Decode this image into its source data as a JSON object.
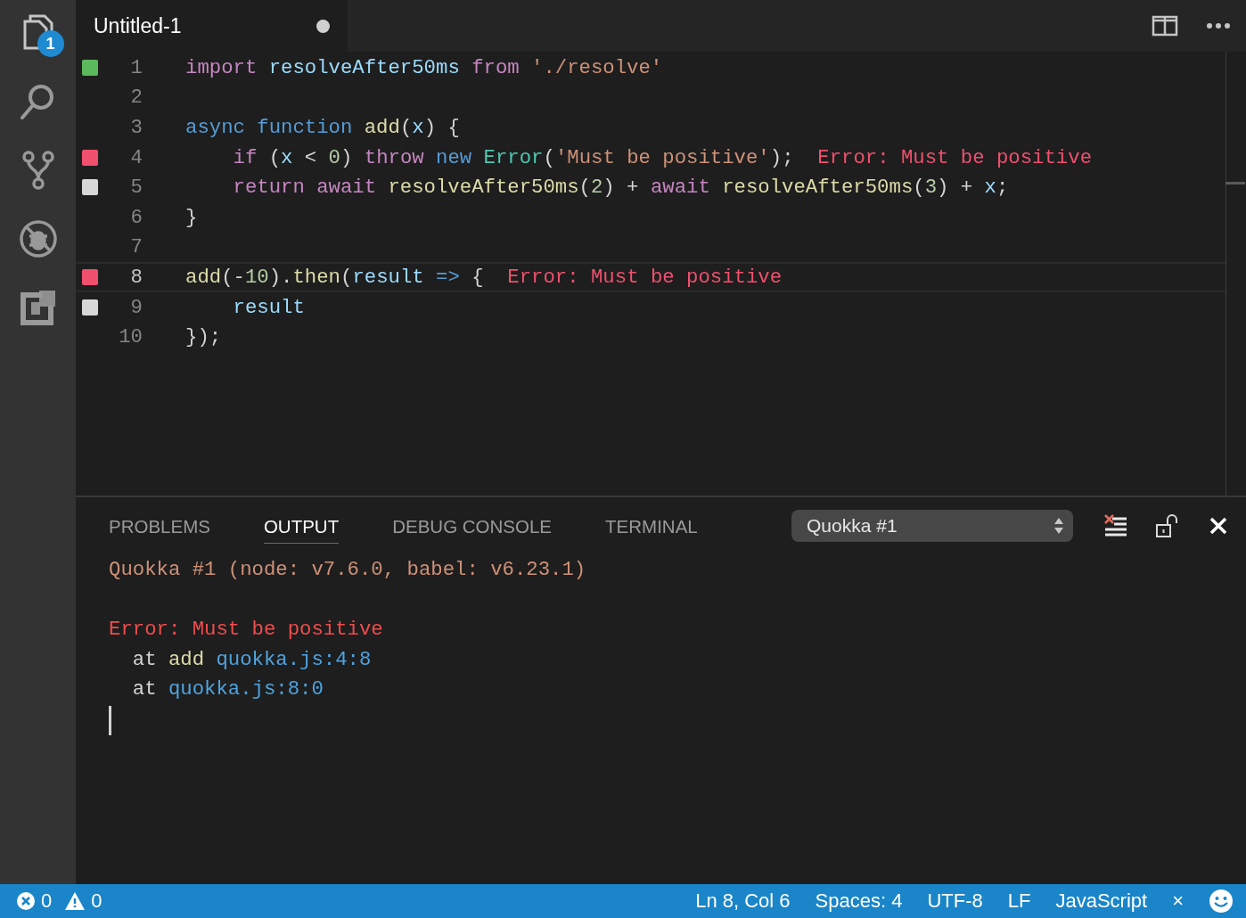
{
  "activity_bar": {
    "items": [
      {
        "kind": "files",
        "selected": true,
        "badge": "1"
      },
      {
        "kind": "search",
        "selected": false
      },
      {
        "kind": "source-control",
        "selected": false
      },
      {
        "kind": "debug",
        "selected": false
      },
      {
        "kind": "extensions",
        "selected": false
      }
    ]
  },
  "editor_tabs": [
    {
      "title": "Untitled-1",
      "selected": true,
      "dirty": true
    }
  ],
  "editor": {
    "lines": [
      {
        "number": "1",
        "color": "#5cb85c",
        "current": false,
        "tokens": [
          {
            "kind": "keyword",
            "text": "import "
          },
          {
            "kind": "var",
            "text": "resolveAfter50ms "
          },
          {
            "kind": "keyword",
            "text": "from "
          },
          {
            "kind": "string",
            "text": "'./resolve'"
          }
        ]
      },
      {
        "number": "2",
        "current": false
      },
      {
        "number": "3",
        "current": false,
        "tokens": [
          {
            "kind": "storage",
            "text": "async function "
          },
          {
            "kind": "function",
            "text": "add"
          },
          {
            "kind": "plain",
            "text": "("
          },
          {
            "kind": "var",
            "text": "x"
          },
          {
            "kind": "plain",
            "text": ") {"
          }
        ]
      },
      {
        "number": "4",
        "color": "#f0506e",
        "current": false,
        "tokens": [
          {
            "kind": "keyword",
            "text": "    if"
          },
          {
            "kind": "plain",
            "text": " ("
          },
          {
            "kind": "var",
            "text": "x"
          },
          {
            "kind": "plain",
            "text": " < "
          },
          {
            "kind": "number",
            "text": "0"
          },
          {
            "kind": "plain",
            "text": ") "
          },
          {
            "kind": "keyword",
            "text": "throw "
          },
          {
            "kind": "storage",
            "text": "new "
          },
          {
            "kind": "type",
            "text": "Error"
          },
          {
            "kind": "plain",
            "text": "("
          },
          {
            "kind": "string",
            "text": "'Must be positive'"
          },
          {
            "kind": "plain",
            "text": ");"
          }
        ],
        "inline_error": "Error: Must be positive"
      },
      {
        "number": "5",
        "color": "#d8d8d8",
        "current": false,
        "tokens": [
          {
            "kind": "keyword",
            "text": "    return await "
          },
          {
            "kind": "function",
            "text": "resolveAfter50ms"
          },
          {
            "kind": "plain",
            "text": "("
          },
          {
            "kind": "number",
            "text": "2"
          },
          {
            "kind": "plain",
            "text": ") + "
          },
          {
            "kind": "keyword",
            "text": "await "
          },
          {
            "kind": "function",
            "text": "resolveAfter50ms"
          },
          {
            "kind": "plain",
            "text": "("
          },
          {
            "kind": "number",
            "text": "3"
          },
          {
            "kind": "plain",
            "text": ") + "
          },
          {
            "kind": "var",
            "text": "x"
          },
          {
            "kind": "plain",
            "text": ";"
          }
        ]
      },
      {
        "number": "6",
        "current": false,
        "tokens": [
          {
            "kind": "plain",
            "text": "}"
          }
        ]
      },
      {
        "number": "7",
        "current": false
      },
      {
        "number": "8",
        "color": "#f0506e",
        "current": true,
        "tokens": [
          {
            "kind": "function",
            "text": "add"
          },
          {
            "kind": "plain",
            "text": "(-"
          },
          {
            "kind": "number",
            "text": "10"
          },
          {
            "kind": "plain",
            "text": ")."
          },
          {
            "kind": "function",
            "text": "then"
          },
          {
            "kind": "plain",
            "text": "("
          },
          {
            "kind": "var",
            "text": "result "
          },
          {
            "kind": "storage",
            "text": "=>"
          },
          {
            "kind": "plain",
            "text": " {"
          }
        ],
        "inline_error": "Error: Must be positive"
      },
      {
        "number": "9",
        "color": "#d8d8d8",
        "current": false,
        "tokens": [
          {
            "kind": "var",
            "text": "    result"
          }
        ]
      },
      {
        "number": "10",
        "current": false,
        "tokens": [
          {
            "kind": "plain",
            "text": "});"
          }
        ]
      }
    ]
  },
  "panel": {
    "tabs": [
      {
        "label": "PROBLEMS",
        "selected": false
      },
      {
        "label": "OUTPUT",
        "selected": true
      },
      {
        "label": "DEBUG CONSOLE",
        "selected": false
      },
      {
        "label": "TERMINAL",
        "selected": false
      }
    ],
    "channel_select": {
      "value": "Quokka #1"
    },
    "output": [
      {
        "kind": "header",
        "tokens": [
          {
            "kind": "string",
            "text": "Quokka #1 (node: v7.6.0, babel: v6.23.1)"
          }
        ]
      },
      {
        "kind": "error",
        "tokens": [
          {
            "kind": "error",
            "text": "Error: Must be positive"
          }
        ]
      },
      {
        "kind": "trace",
        "tokens": [
          {
            "kind": "plain",
            "text": "  at "
          },
          {
            "kind": "function",
            "text": "add "
          },
          {
            "kind": "link",
            "text": "quokka.js:4:8"
          }
        ]
      },
      {
        "kind": "trace",
        "tokens": [
          {
            "kind": "plain",
            "text": "  at "
          },
          {
            "kind": "link",
            "text": "quokka.js:8:0"
          }
        ]
      }
    ]
  },
  "status_bar": {
    "errors": "0",
    "warnings": "0",
    "items": [
      "Ln 8, Col 6",
      "Spaces: 4",
      "UTF-8",
      "LF",
      "JavaScript",
      "×"
    ]
  }
}
